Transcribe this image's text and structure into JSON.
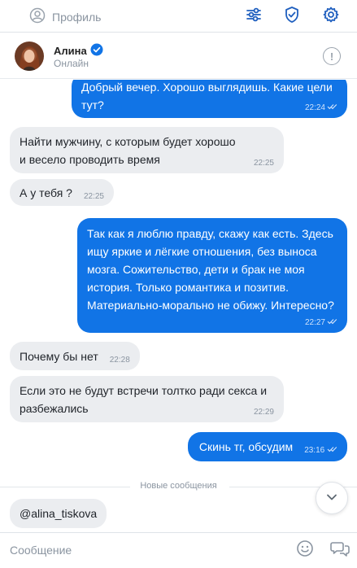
{
  "colors": {
    "accent": "#1174e6",
    "incoming_bubble": "#ebedf0",
    "muted_text": "#8a94a0",
    "verified_badge": "#1174e6"
  },
  "topbar": {
    "profile_label": "Профиль",
    "icons": [
      "profile-icon",
      "filters-icon",
      "shield-icon",
      "settings-icon"
    ]
  },
  "chat_header": {
    "name": "Алина",
    "status": "Онлайн",
    "verified": true,
    "info_icon": "!"
  },
  "messages": [
    {
      "direction": "out",
      "text": "Добрый вечер. Хорошо выглядишь. Какие цели тут?",
      "time": "22:24",
      "read": true
    },
    {
      "direction": "in",
      "text": "Найти мужчину, с которым будет хорошо и весело проводить время",
      "time": "22:25"
    },
    {
      "direction": "in",
      "text": "А у тебя ?",
      "time": "22:25"
    },
    {
      "direction": "out",
      "text": "Так как я люблю правду, скажу как есть. Здесь ищу яркие и лёгкие отношения, без выноса мозга. Сожительство, дети и брак не моя история. Только романтика и позитив. Материально-морально не обижу. Интересно?",
      "time": "22:27",
      "read": true
    },
    {
      "direction": "in",
      "text": "Почему бы нет",
      "time": "22:28"
    },
    {
      "direction": "in",
      "text": "Если это не будут встречи толтко ради секса и разбежались",
      "time": "22:29"
    },
    {
      "direction": "out",
      "text": "Скинь тг, обсудим",
      "time": "23:16",
      "read": true
    },
    {
      "direction": "in",
      "text": "@alina_tiskova",
      "time": ""
    }
  ],
  "divider": {
    "label": "Новые сообщения"
  },
  "composer": {
    "placeholder": "Сообщение",
    "value": ""
  }
}
